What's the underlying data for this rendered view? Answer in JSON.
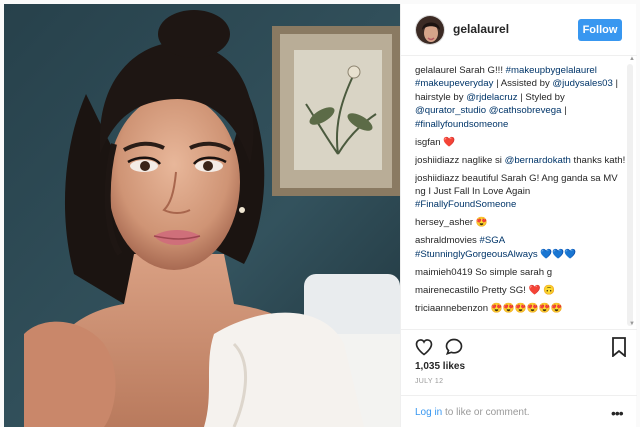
{
  "post": {
    "username": "gelalaurel",
    "follow_label": "Follow",
    "likes": "1,035 likes",
    "date": "JULY 12",
    "login_link": "Log in",
    "login_rest": " to like or comment."
  },
  "comments": [
    {
      "user": "gelalaurel",
      "text": " Sarah G!!! ",
      "links": "#makeupbygelalaurel #makeupeveryday",
      "text2": " | Assisted by ",
      "links2": "@judysales03",
      "text3": " | hairstyle by ",
      "links3": "@rjdelacruz",
      "text4": " | Styled by ",
      "links4": "@qurator_studio @cathsobrevega",
      "text5": " | ",
      "links5": "#finallyfoundsomeone"
    },
    {
      "user": "isgfan",
      "text": " ❤️",
      "links": "",
      "text2": "",
      "links2": "",
      "text3": "",
      "links3": "",
      "text4": "",
      "links4": "",
      "text5": "",
      "links5": ""
    },
    {
      "user": "joshiidiazz",
      "text": " naglike si ",
      "links": "@bernardokath",
      "text2": " thanks kath!",
      "links2": "",
      "text3": "",
      "links3": "",
      "text4": "",
      "links4": "",
      "text5": "",
      "links5": ""
    },
    {
      "user": "joshiidiazz",
      "text": " beautiful Sarah G! Ang ganda sa MV ng I Just Fall In Love Again ",
      "links": "#FinallyFoundSomeone",
      "text2": "",
      "links2": "",
      "text3": "",
      "links3": "",
      "text4": "",
      "links4": "",
      "text5": "",
      "links5": ""
    },
    {
      "user": "hersey_asher",
      "text": " 😍",
      "links": "",
      "text2": "",
      "links2": "",
      "text3": "",
      "links3": "",
      "text4": "",
      "links4": "",
      "text5": "",
      "links5": ""
    },
    {
      "user": "ashraldmovies",
      "text": " ",
      "links": "#SGA #StunninglyGorgeousAlways",
      "text2": " 💙💙💙",
      "links2": "",
      "text3": "",
      "links3": "",
      "text4": "",
      "links4": "",
      "text5": "",
      "links5": ""
    },
    {
      "user": "maimieh0419",
      "text": " So simple sarah g",
      "links": "",
      "text2": "",
      "links2": "",
      "text3": "",
      "links3": "",
      "text4": "",
      "links4": "",
      "text5": "",
      "links5": ""
    },
    {
      "user": "mairenecastillo",
      "text": " Pretty SG! ❤️ 🙃",
      "links": "",
      "text2": "",
      "links2": "",
      "text3": "",
      "links3": "",
      "text4": "",
      "links4": "",
      "text5": "",
      "links5": ""
    },
    {
      "user": "triciaannebenzon",
      "text": " 😍😍😍😍😍😍",
      "links": "",
      "text2": "",
      "links2": "",
      "text3": "",
      "links3": "",
      "text4": "",
      "links4": "",
      "text5": "",
      "links5": ""
    }
  ],
  "icons": {
    "heart": "heart-outline-icon",
    "comment": "comment-bubble-icon",
    "bookmark": "bookmark-icon",
    "more": "more-options-icon"
  },
  "colors": {
    "accent": "#3897f0",
    "link": "#003569",
    "wall": "#2c4650"
  }
}
